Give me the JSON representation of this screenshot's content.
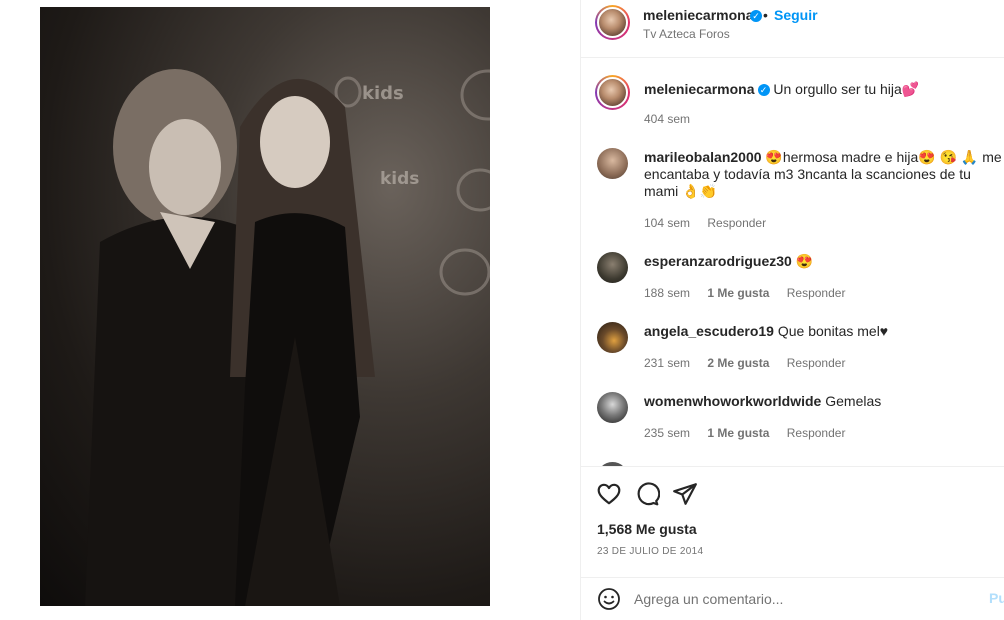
{
  "header": {
    "username": "meleniecarmona",
    "follow_label": "Seguir",
    "separator": "•",
    "location": "Tv Azteca Foros"
  },
  "caption": {
    "username": "meleniecarmona",
    "text": "Un orgullo ser tu hija💕",
    "time": "404 sem"
  },
  "comments": [
    {
      "username": "marileobalan2000",
      "text": "😍hermosa madre e hija😍 😘 🙏 me encantaba y todavía m3 3ncanta la scanciones de tu mami 👌👏",
      "time": "104 sem",
      "likes": "",
      "reply": "Responder"
    },
    {
      "username": "esperanzarodriguez30",
      "text": "😍",
      "time": "188 sem",
      "likes": "1 Me gusta",
      "reply": "Responder"
    },
    {
      "username": "angela_escudero19",
      "text": "Que bonitas mel♥",
      "time": "231 sem",
      "likes": "2 Me gusta",
      "reply": "Responder"
    },
    {
      "username": "womenwhoworkworldwide",
      "text": "Gemelas",
      "time": "235 sem",
      "likes": "1 Me gusta",
      "reply": "Responder"
    }
  ],
  "actions": {
    "like_icon": "heart-icon",
    "comment_icon": "comment-icon",
    "share_icon": "share-icon"
  },
  "likes_text": "1,568 Me gusta",
  "date_text": "23 DE JULIO DE 2014",
  "add_comment": {
    "placeholder": "Agrega un comentario...",
    "post_label": "Pu"
  },
  "colors": {
    "accent": "#0095f6",
    "muted": "#737373",
    "text": "#262626",
    "post_disabled": "#b2dffc"
  }
}
